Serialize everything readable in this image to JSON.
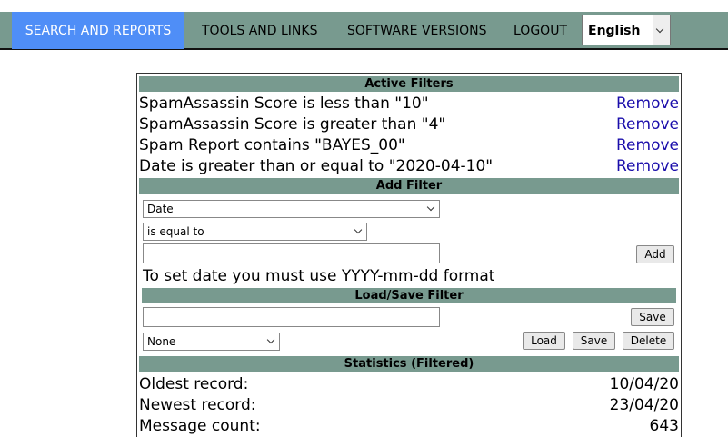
{
  "nav": {
    "items": [
      "SEARCH AND REPORTS",
      "TOOLS AND LINKS",
      "SOFTWARE VERSIONS",
      "LOGOUT"
    ],
    "active_index": 0,
    "language": "English"
  },
  "active_filters": {
    "title": "Active Filters",
    "remove_label": "Remove",
    "items": [
      "SpamAssassin Score is less than \"10\"",
      "SpamAssassin Score is greater than \"4\"",
      "Spam Report contains \"BAYES_00\"",
      "Date is greater than or equal to \"2020-04-10\""
    ]
  },
  "add_filter": {
    "title": "Add Filter",
    "field_select": "Date",
    "operator_select": "is equal to",
    "value": "",
    "add_label": "Add",
    "note": "To set date you must use YYYY-mm-dd format"
  },
  "load_save": {
    "title": "Load/Save Filter",
    "name_value": "",
    "save_label": "Save",
    "saved_select": "None",
    "load_label": "Load",
    "save2_label": "Save",
    "delete_label": "Delete"
  },
  "statistics": {
    "title": "Statistics (Filtered)",
    "rows": [
      {
        "label": "Oldest record:",
        "value": "10/04/20"
      },
      {
        "label": "Newest record:",
        "value": "23/04/20"
      },
      {
        "label": "Message count:",
        "value": "643"
      }
    ]
  }
}
